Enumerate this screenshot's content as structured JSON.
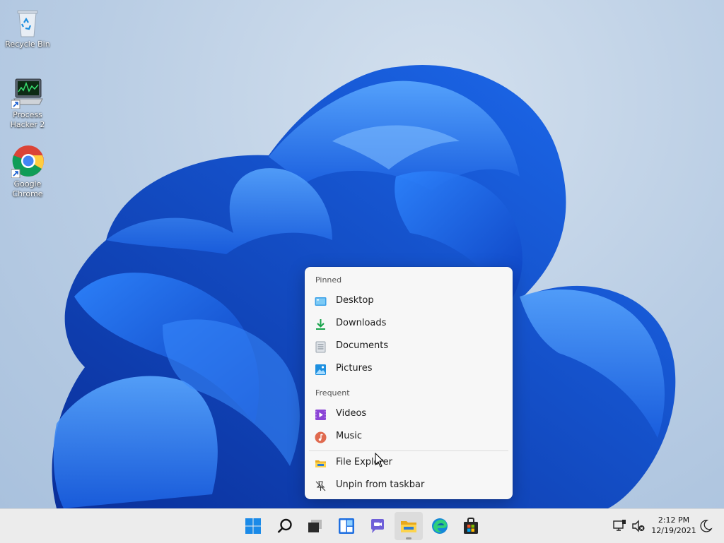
{
  "desktop": {
    "icons": [
      {
        "label": "Recycle Bin"
      },
      {
        "label_line1": "Process",
        "label_line2": "Hacker 2"
      },
      {
        "label_line1": "Google",
        "label_line2": "Chrome"
      }
    ]
  },
  "jumplist": {
    "pinned_header": "Pinned",
    "pinned": [
      {
        "label": "Desktop",
        "icon": "desktop-folder-icon"
      },
      {
        "label": "Downloads",
        "icon": "downloads-icon"
      },
      {
        "label": "Documents",
        "icon": "documents-icon"
      },
      {
        "label": "Pictures",
        "icon": "pictures-icon"
      }
    ],
    "frequent_header": "Frequent",
    "frequent": [
      {
        "label": "Videos",
        "icon": "videos-icon"
      },
      {
        "label": "Music",
        "icon": "music-icon"
      }
    ],
    "actions": [
      {
        "label": "File Explorer",
        "icon": "file-explorer-icon"
      },
      {
        "label": "Unpin from taskbar",
        "icon": "unpin-icon"
      }
    ]
  },
  "taskbar": {
    "buttons": [
      "start",
      "search",
      "task-view",
      "widgets",
      "teams-chat",
      "file-explorer",
      "edge",
      "store"
    ],
    "active": "file-explorer"
  },
  "tray": {
    "time": "2:12 PM",
    "date": "12/19/2021"
  },
  "colors": {
    "accent": "#0067c0",
    "bloom_blue": "#1a5fe0",
    "taskbar": "#ececec"
  }
}
